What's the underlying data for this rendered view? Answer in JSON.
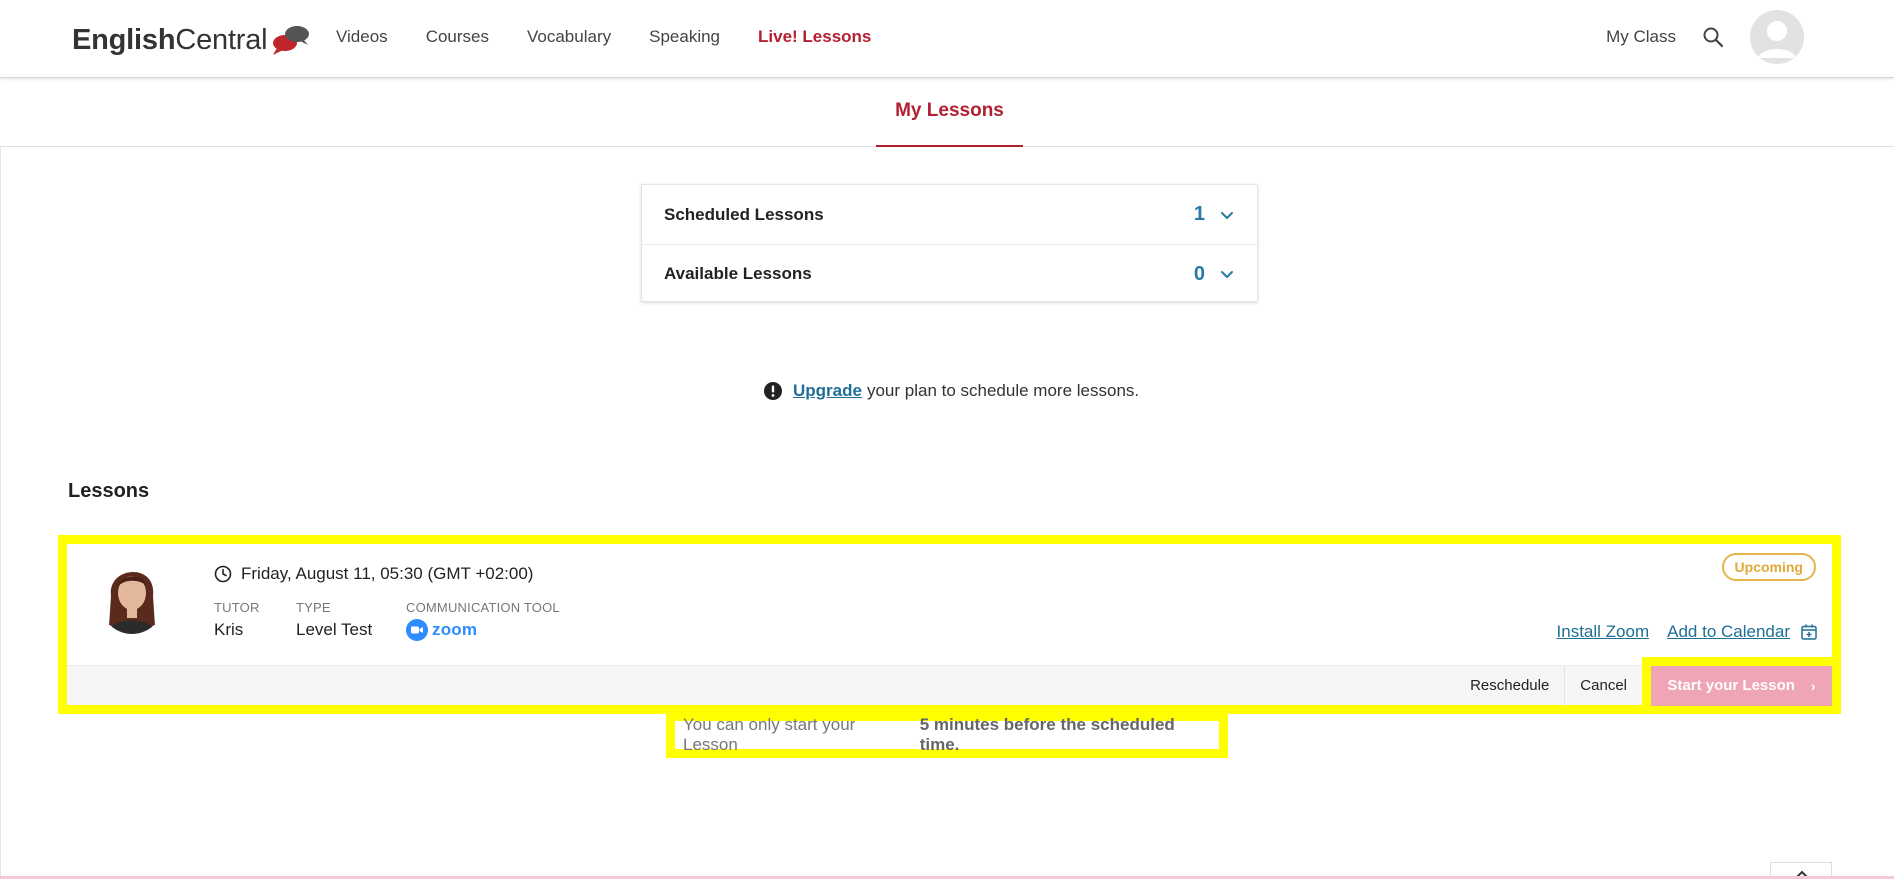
{
  "header": {
    "logo_bold": "English",
    "logo_light": "Central",
    "nav": [
      {
        "label": "Videos"
      },
      {
        "label": "Courses"
      },
      {
        "label": "Vocabulary"
      },
      {
        "label": "Speaking"
      },
      {
        "label": "Live! Lessons",
        "active": true
      }
    ],
    "my_class": "My Class",
    "search_icon": "search-icon",
    "avatar_icon": "user-avatar-icon"
  },
  "tabs": {
    "active_tab": "My Lessons"
  },
  "accordion": [
    {
      "label": "Scheduled Lessons",
      "count": "1"
    },
    {
      "label": "Available Lessons",
      "count": "0"
    }
  ],
  "notice": {
    "link": "Upgrade",
    "text": "your plan to schedule more lessons."
  },
  "lessons": {
    "heading": "Lessons",
    "items": [
      {
        "datetime": "Friday, August 11, 05:30 (GMT +02:00)",
        "tutor_label": "TUTOR",
        "tutor": "Kris",
        "type_label": "TYPE",
        "type": "Level Test",
        "tool_label": "COMMUNICATION TOOL",
        "tool": "zoom",
        "status": "Upcoming",
        "install_zoom": "Install Zoom",
        "add_to_calendar": "Add to Calendar",
        "reschedule": "Reschedule",
        "cancel": "Cancel",
        "start": "Start your Lesson"
      }
    ]
  },
  "foot_note": {
    "text": "You can only start your Lesson",
    "bold": "5 minutes before the scheduled time."
  },
  "colors": {
    "brand_red": "#b32033",
    "link_blue": "#1f6f96",
    "count_blue": "#2a7aa6",
    "highlight_yellow": "#ffff00",
    "badge_gold": "#e0a93a",
    "start_disabled_pink": "#ef9db0"
  }
}
